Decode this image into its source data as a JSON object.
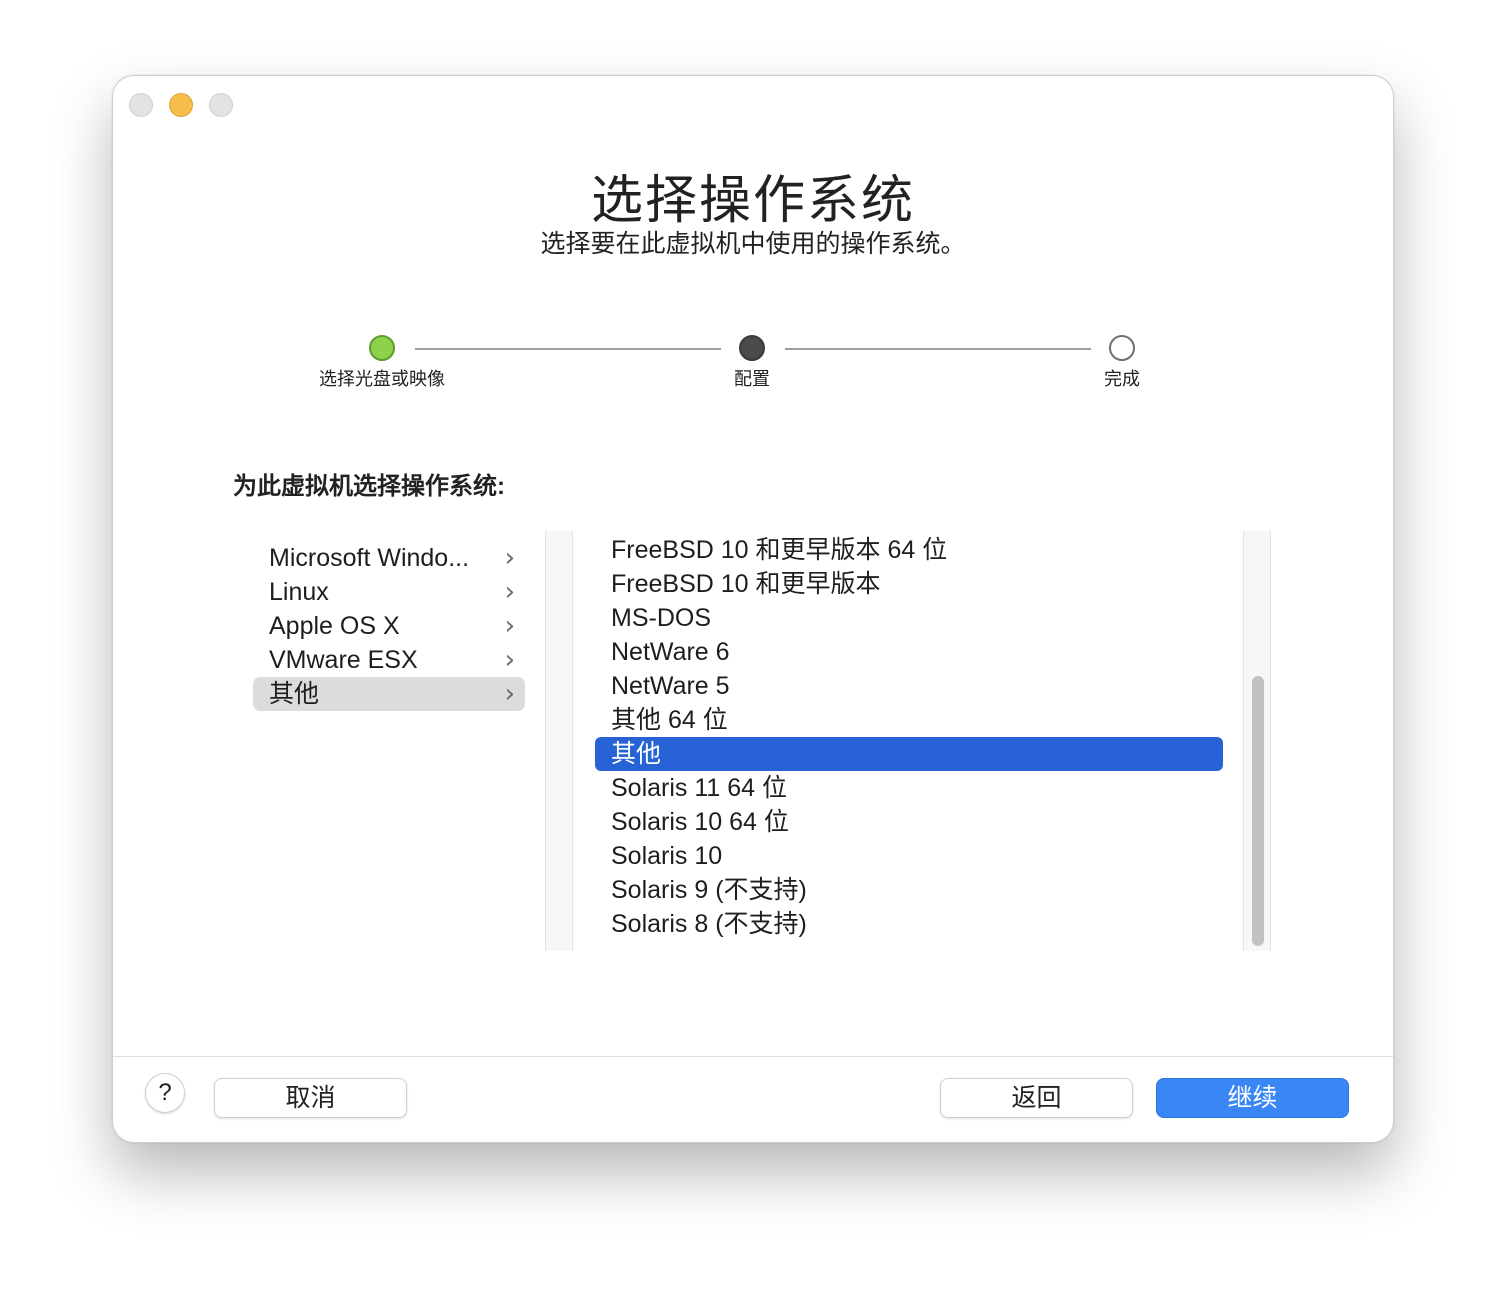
{
  "dialog": {
    "title": "选择操作系统",
    "subtitle": "选择要在此虚拟机中使用的操作系统。"
  },
  "steps": [
    {
      "label": "选择光盘或映像",
      "state": "done"
    },
    {
      "label": "配置",
      "state": "current"
    },
    {
      "label": "完成",
      "state": "todo"
    }
  ],
  "section_label": "为此虚拟机选择操作系统:",
  "categories": [
    {
      "label": "Microsoft Windo...",
      "selected": false
    },
    {
      "label": "Linux",
      "selected": false
    },
    {
      "label": "Apple OS X",
      "selected": false
    },
    {
      "label": "VMware ESX",
      "selected": false
    },
    {
      "label": "其他",
      "selected": true
    }
  ],
  "os_list": [
    {
      "label": "FreeBSD 10 和更早版本 64 位",
      "selected": false
    },
    {
      "label": "FreeBSD 10 和更早版本",
      "selected": false
    },
    {
      "label": "MS-DOS",
      "selected": false
    },
    {
      "label": "NetWare 6",
      "selected": false
    },
    {
      "label": "NetWare 5",
      "selected": false
    },
    {
      "label": "其他 64 位",
      "selected": false
    },
    {
      "label": "其他",
      "selected": true
    },
    {
      "label": "Solaris 11 64 位",
      "selected": false
    },
    {
      "label": "Solaris 10 64 位",
      "selected": false
    },
    {
      "label": "Solaris 10",
      "selected": false
    },
    {
      "label": "Solaris 9 (不支持)",
      "selected": false
    },
    {
      "label": "Solaris 8 (不支持)",
      "selected": false
    }
  ],
  "footer": {
    "help_label": "?",
    "cancel_label": "取消",
    "back_label": "返回",
    "continue_label": "继续"
  },
  "colors": {
    "selection": "#2763d6",
    "primary_button": "#3a86f4",
    "step_done": "#8ed14b"
  }
}
